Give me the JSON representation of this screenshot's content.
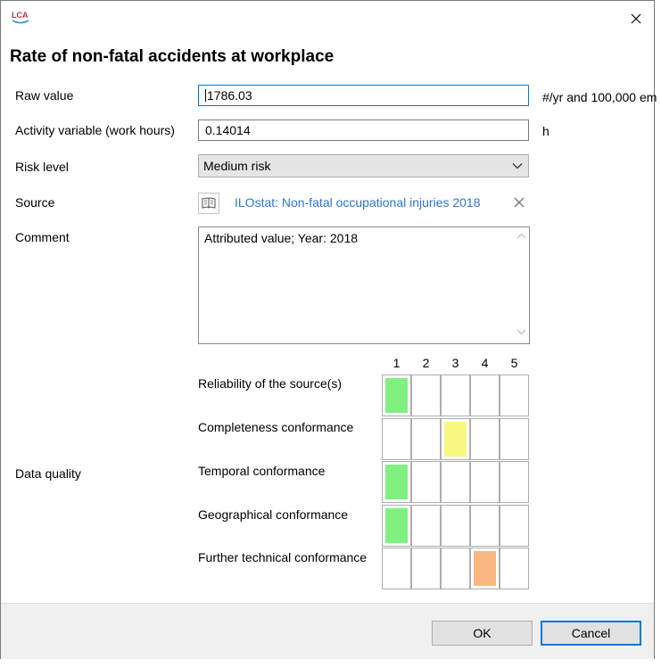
{
  "dialog": {
    "title": "Rate of non-fatal accidents at workplace",
    "app_icon_text": "LCA"
  },
  "form": {
    "raw_value": {
      "label": "Raw value",
      "value": "1786.03",
      "unit": "#/yr and 100,000 em"
    },
    "activity": {
      "label": "Activity variable (work hours)",
      "value": "0.14014",
      "unit": "h"
    },
    "risk_level": {
      "label": "Risk level",
      "value": "Medium risk"
    },
    "source": {
      "label": "Source",
      "link": "ILOstat: Non-fatal occupational injuries 2018"
    },
    "comment": {
      "label": "Comment",
      "value": "Attributed value; Year: 2018"
    }
  },
  "data_quality": {
    "label": "Data quality",
    "columns": [
      "1",
      "2",
      "3",
      "4",
      "5"
    ],
    "rows": [
      {
        "label": "Reliability of the source(s)",
        "selected": 1,
        "color": "#80f080"
      },
      {
        "label": "Completeness conformance",
        "selected": 3,
        "color": "#f8f880"
      },
      {
        "label": "Temporal conformance",
        "selected": 1,
        "color": "#80f080"
      },
      {
        "label": "Geographical  conformance",
        "selected": 1,
        "color": "#80f080"
      },
      {
        "label": "Further technical conformance",
        "selected": 4,
        "color": "#f8b880"
      }
    ]
  },
  "footer": {
    "ok_label": "OK",
    "cancel_label": "Cancel"
  },
  "icons": {
    "app": "lca-app-icon",
    "close": "close-icon",
    "dropdown": "chevron-down-icon",
    "source_book": "book-icon",
    "source_remove": "remove-icon"
  },
  "colors": {
    "accent": "#0078d7",
    "link": "#2e75cf",
    "score_green": "#80f080",
    "score_yellow": "#f8f880",
    "score_orange": "#f8b880"
  }
}
